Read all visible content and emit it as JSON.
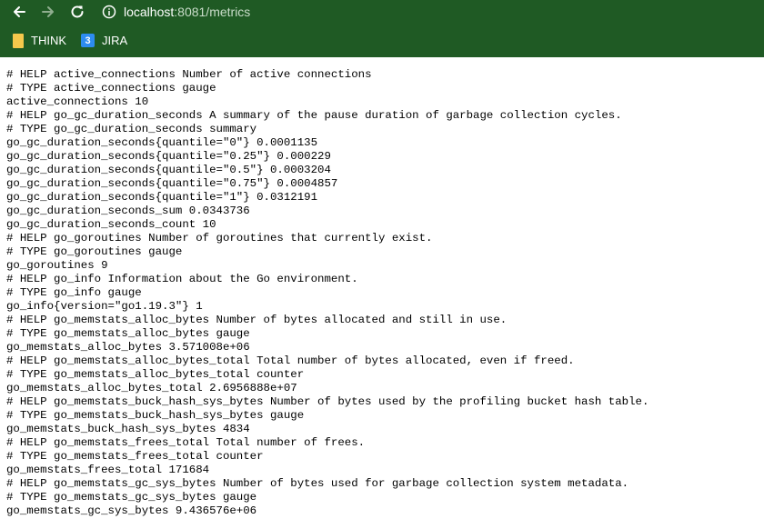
{
  "browser": {
    "url_host": "localhost",
    "url_rest": ":8081/metrics",
    "bookmarks": [
      {
        "label": "THINK",
        "icon": "folder-icon"
      },
      {
        "label": "JIRA",
        "icon": "jira-icon",
        "icon_glyph": "3"
      }
    ],
    "colors": {
      "chrome": "#1f5a24",
      "folder": "#f5c84c",
      "jira": "#2d8cf0"
    }
  },
  "page": {
    "lines": [
      "# HELP active_connections Number of active connections",
      "# TYPE active_connections gauge",
      "active_connections 10",
      "# HELP go_gc_duration_seconds A summary of the pause duration of garbage collection cycles.",
      "# TYPE go_gc_duration_seconds summary",
      "go_gc_duration_seconds{quantile=\"0\"} 0.0001135",
      "go_gc_duration_seconds{quantile=\"0.25\"} 0.000229",
      "go_gc_duration_seconds{quantile=\"0.5\"} 0.0003204",
      "go_gc_duration_seconds{quantile=\"0.75\"} 0.0004857",
      "go_gc_duration_seconds{quantile=\"1\"} 0.0312191",
      "go_gc_duration_seconds_sum 0.0343736",
      "go_gc_duration_seconds_count 10",
      "# HELP go_goroutines Number of goroutines that currently exist.",
      "# TYPE go_goroutines gauge",
      "go_goroutines 9",
      "# HELP go_info Information about the Go environment.",
      "# TYPE go_info gauge",
      "go_info{version=\"go1.19.3\"} 1",
      "# HELP go_memstats_alloc_bytes Number of bytes allocated and still in use.",
      "# TYPE go_memstats_alloc_bytes gauge",
      "go_memstats_alloc_bytes 3.571008e+06",
      "# HELP go_memstats_alloc_bytes_total Total number of bytes allocated, even if freed.",
      "# TYPE go_memstats_alloc_bytes_total counter",
      "go_memstats_alloc_bytes_total 2.6956888e+07",
      "# HELP go_memstats_buck_hash_sys_bytes Number of bytes used by the profiling bucket hash table.",
      "# TYPE go_memstats_buck_hash_sys_bytes gauge",
      "go_memstats_buck_hash_sys_bytes 4834",
      "# HELP go_memstats_frees_total Total number of frees.",
      "# TYPE go_memstats_frees_total counter",
      "go_memstats_frees_total 171684",
      "# HELP go_memstats_gc_sys_bytes Number of bytes used for garbage collection system metadata.",
      "# TYPE go_memstats_gc_sys_bytes gauge",
      "go_memstats_gc_sys_bytes 9.436576e+06"
    ]
  }
}
